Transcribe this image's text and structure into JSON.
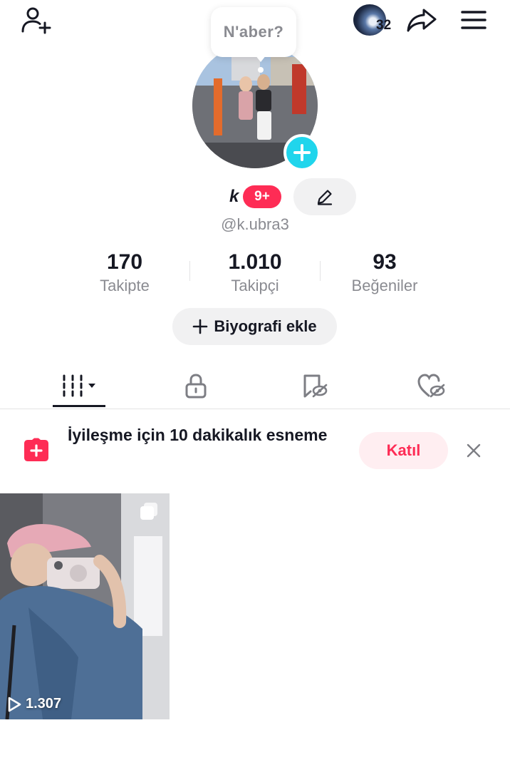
{
  "header": {
    "add_user_icon": "person-plus-icon",
    "story_count": "32",
    "share_icon": "share-arrow-icon",
    "menu_icon": "hamburger-icon"
  },
  "note_bubble": "N'aber?",
  "profile": {
    "name_glyph": "k",
    "notification_badge": "9+",
    "username": "@k.ubra3",
    "add_icon": "plus-icon",
    "edit_icon": "pencil-icon"
  },
  "stats": {
    "following": {
      "value": "170",
      "label": "Takipte"
    },
    "followers": {
      "value": "1.010",
      "label": "Takipçi"
    },
    "likes": {
      "value": "93",
      "label": "Beğeniler"
    }
  },
  "bio_button": "Biyografi ekle",
  "tabs": [
    {
      "name": "videos",
      "icon": "grid-icon",
      "active": true
    },
    {
      "name": "private",
      "icon": "lock-icon"
    },
    {
      "name": "reposts",
      "icon": "repost-hidden-icon"
    },
    {
      "name": "liked",
      "icon": "heart-hidden-icon"
    }
  ],
  "banner": {
    "text": "İyileşme için 10 dakikalık esneme",
    "join_label": "Katıl",
    "icon": "plus-square-icon",
    "close_icon": "close-icon"
  },
  "videos": [
    {
      "views": "1.307"
    }
  ],
  "colors": {
    "accent": "#fe2c55",
    "teal": "#20d5ec",
    "text": "#161823",
    "muted": "#8a8b91",
    "pill_bg": "#f1f1f2"
  }
}
